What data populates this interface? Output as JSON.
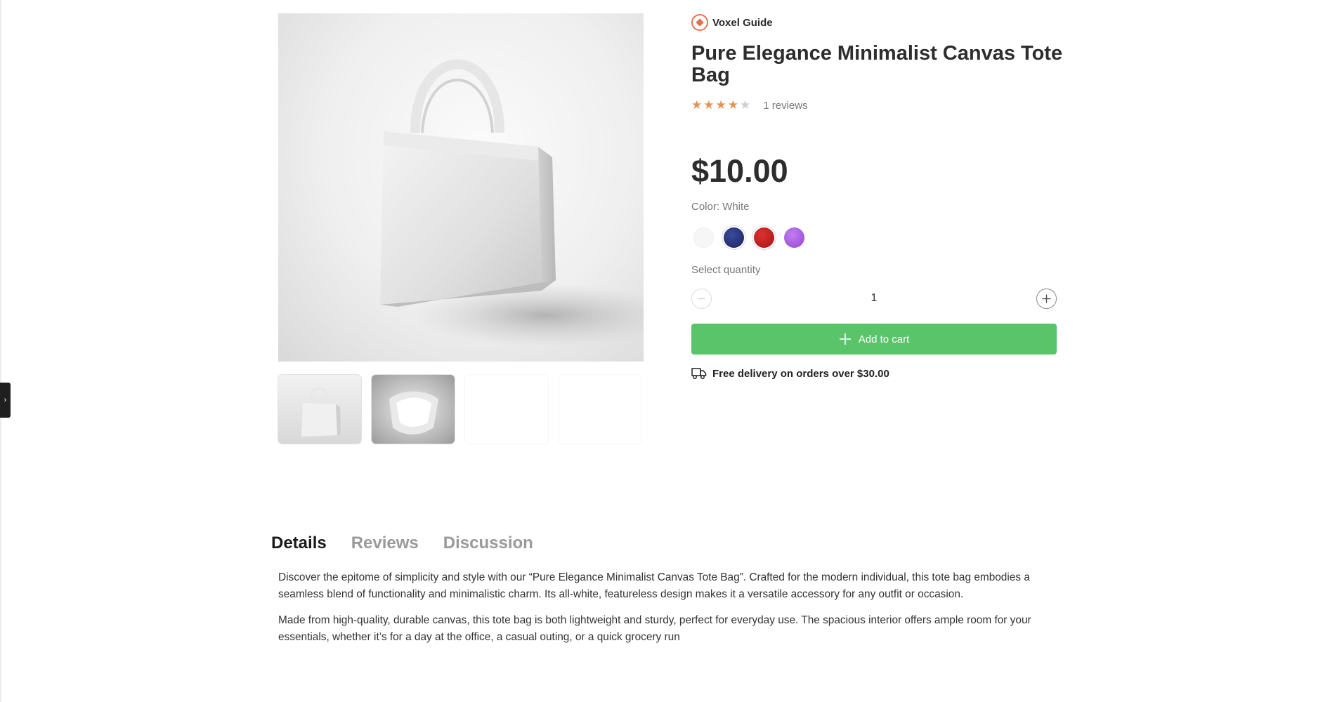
{
  "brand": {
    "name": "Voxel Guide"
  },
  "product": {
    "title": "Pure Elegance Minimalist Canvas Tote Bag",
    "rating": 4,
    "rating_max": 5,
    "reviews_label": "1 reviews",
    "price": "$10.00",
    "color_label": "Color: White",
    "colors": [
      "#f6f6f6",
      "#26307a",
      "#c21f1f",
      "#ac62e3"
    ],
    "quantity_label": "Select quantity",
    "quantity": "1",
    "add_to_cart_label": "Add to cart",
    "delivery_text": "Free delivery on orders over $30.00"
  },
  "tabs": {
    "details": "Details",
    "reviews": "Reviews",
    "discussion": "Discussion"
  },
  "description": {
    "p1": "Discover the epitome of simplicity and style with our “Pure Elegance Minimalist Canvas Tote Bag”. Crafted for the modern individual, this tote bag embodies a seamless blend of functionality and minimalistic charm. Its all-white, featureless design makes it a versatile accessory for any outfit or occasion.",
    "p2": "Made from high-quality, durable canvas, this tote bag is both lightweight and sturdy, perfect for everyday use. The spacious interior offers ample room for your essentials, whether it’s for a day at the office, a casual outing, or a quick grocery run"
  },
  "ui": {
    "sidebar_toggle": "›",
    "accent": "#5ac46b",
    "brand_color": "#e5714a",
    "star_color": "#e59150"
  }
}
